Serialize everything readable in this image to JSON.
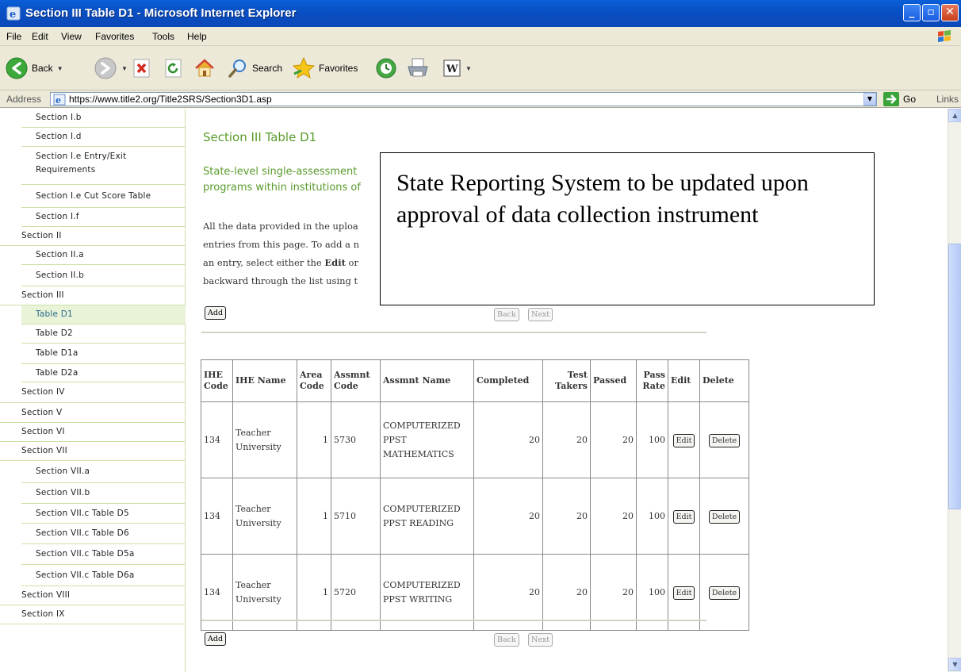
{
  "window": {
    "title": "Section III Table D1 - Microsoft Internet Explorer",
    "min_label": "_",
    "max_label": "▫",
    "close_label": "✕"
  },
  "menu": [
    "File",
    "Edit",
    "View",
    "Favorites",
    "Tools",
    "Help"
  ],
  "toolbar": {
    "back_label": "Back",
    "search_label": "Search",
    "favorites_label": "Favorites"
  },
  "address": {
    "label": "Address",
    "url": "https://www.title2.org/Title2SRS/Section3D1.asp",
    "go_label": "Go",
    "links_label": "Links"
  },
  "sidebar": {
    "items": [
      {
        "label": "Section I.b",
        "level": 2
      },
      {
        "label": "Section I.d",
        "level": 2
      },
      {
        "label": "Section I.e Entry/Exit Requirements",
        "level": 2
      },
      {
        "label": "Section I.e Cut Score Table",
        "level": 2
      },
      {
        "label": "Section I.f",
        "level": 2
      },
      {
        "label": "Section II",
        "level": 1
      },
      {
        "label": "Section II.a",
        "level": 2
      },
      {
        "label": "Section II.b",
        "level": 2
      },
      {
        "label": "Section III",
        "level": 1
      },
      {
        "label": "Table D1",
        "level": 2,
        "selected": true
      },
      {
        "label": "Table D2",
        "level": 2
      },
      {
        "label": "Table D1a",
        "level": 2
      },
      {
        "label": "Table D2a",
        "level": 2
      },
      {
        "label": "Section IV",
        "level": 1
      },
      {
        "label": "Section V",
        "level": 1
      },
      {
        "label": "Section VI",
        "level": 1
      },
      {
        "label": "Section VII",
        "level": 1
      },
      {
        "label": "Section VII.a",
        "level": 2
      },
      {
        "label": "Section VII.b",
        "level": 2
      },
      {
        "label": "Section VII.c Table D5",
        "level": 2
      },
      {
        "label": "Section VII.c Table D6",
        "level": 2
      },
      {
        "label": "Section VII.c Table D5a",
        "level": 2
      },
      {
        "label": "Section VII.c Table D6a",
        "level": 2
      },
      {
        "label": "Section VIII",
        "level": 1
      },
      {
        "label": "Section IX",
        "level": 1
      }
    ]
  },
  "main": {
    "title": "Section III Table D1",
    "subtitle_lines": [
      "State-level single-assessment",
      "programs within institutions of"
    ],
    "intro_lines": [
      "All the data provided in the uploa",
      "entries from this page. To add a n",
      "an entry, select either the Edit or",
      "backward through the list using t"
    ],
    "add_label": "Add",
    "back_label": "Back",
    "next_label": "Next",
    "table": {
      "headers": [
        "IHE Code",
        "IHE Name",
        "Area Code",
        "Assmnt Code",
        "Assmnt Name",
        "Completed",
        "Test Takers",
        "Passed",
        "Pass Rate",
        "Edit",
        "Delete"
      ],
      "rows": [
        {
          "ihe_code": "134",
          "ihe_name": "Teacher University",
          "area_code": "1",
          "assmnt_code": "5730",
          "assmnt_name": "COMPUTERIZED PPST MATHEMATICS",
          "completed": "20",
          "test_takers": "20",
          "passed": "20",
          "pass_rate": "100"
        },
        {
          "ihe_code": "134",
          "ihe_name": "Teacher University",
          "area_code": "1",
          "assmnt_code": "5710",
          "assmnt_name": "COMPUTERIZED PPST READING",
          "completed": "20",
          "test_takers": "20",
          "passed": "20",
          "pass_rate": "100"
        },
        {
          "ihe_code": "134",
          "ihe_name": "Teacher University",
          "area_code": "1",
          "assmnt_code": "5720",
          "assmnt_name": "COMPUTERIZED PPST WRITING",
          "completed": "20",
          "test_takers": "20",
          "passed": "20",
          "pass_rate": "100"
        }
      ],
      "edit_label": "Edit",
      "delete_label": "Delete"
    }
  },
  "callout": {
    "text": "State Reporting System to be updated upon approval of data collection instrument"
  }
}
